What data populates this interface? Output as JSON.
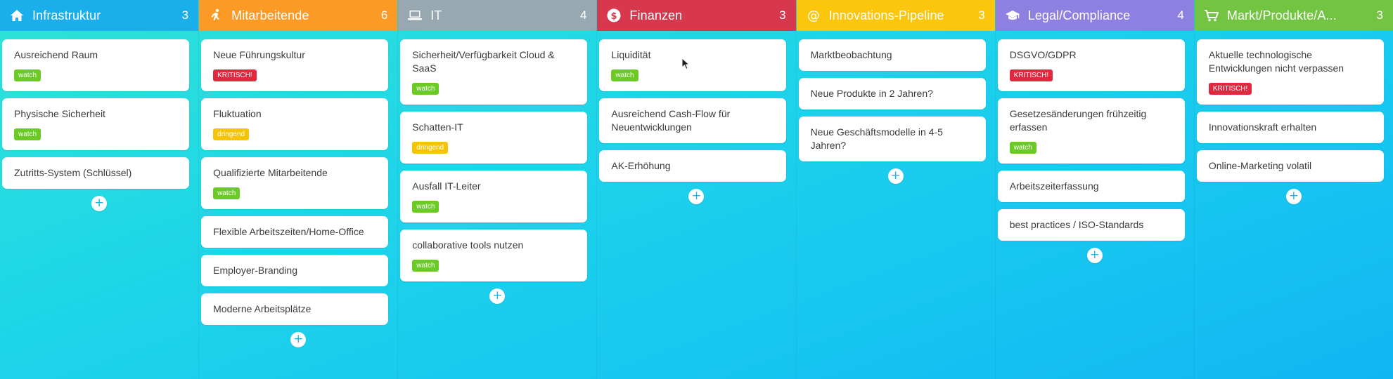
{
  "colors": {
    "watch": "#6bcb24",
    "kritisch": "#e0283f",
    "dringend": "#f5c505"
  },
  "columns": [
    {
      "title": "Infrastruktur",
      "count": "3",
      "color": "#1aaeeb",
      "icon": "house-icon",
      "cards": [
        {
          "title": "Ausreichend Raum",
          "badge": "watch",
          "badge_type": "watch"
        },
        {
          "title": "Physische Sicherheit",
          "badge": "watch",
          "badge_type": "watch"
        },
        {
          "title": "Zutritts-System (Schlüssel)"
        }
      ]
    },
    {
      "title": "Mitarbeitende",
      "count": "6",
      "color": "#fb9b26",
      "icon": "runner-icon",
      "cards": [
        {
          "title": "Neue Führungskultur",
          "badge": "KRITISCH!",
          "badge_type": "kritisch"
        },
        {
          "title": "Fluktuation",
          "badge": "dringend",
          "badge_type": "dringend"
        },
        {
          "title": "Qualifizierte Mitarbeitende",
          "badge": "watch",
          "badge_type": "watch"
        },
        {
          "title": "Flexible Arbeitszeiten/Home-Office"
        },
        {
          "title": "Employer-Branding"
        },
        {
          "title": "Moderne Arbeitsplätze"
        }
      ]
    },
    {
      "title": "IT",
      "count": "4",
      "color": "#98a8b1",
      "icon": "laptop-icon",
      "cards": [
        {
          "title": "Sicherheit/Verfügbarkeit Cloud & SaaS",
          "badge": "watch",
          "badge_type": "watch"
        },
        {
          "title": "Schatten-IT",
          "badge": "dringend",
          "badge_type": "dringend"
        },
        {
          "title": "Ausfall IT-Leiter",
          "badge": "watch",
          "badge_type": "watch"
        },
        {
          "title": "collaborative tools nutzen",
          "badge": "watch",
          "badge_type": "watch"
        }
      ]
    },
    {
      "title": "Finanzen",
      "count": "3",
      "color": "#d8384e",
      "icon": "dollar-icon",
      "cards": [
        {
          "title": "Liquidität",
          "badge": "watch",
          "badge_type": "watch"
        },
        {
          "title": "Ausreichend Cash-Flow für Neuentwicklungen"
        },
        {
          "title": "AK-Erhöhung"
        }
      ]
    },
    {
      "title": "Innovations-Pipeline",
      "count": "3",
      "color": "#fcc60c",
      "icon": "at-icon",
      "cards": [
        {
          "title": "Marktbeobachtung"
        },
        {
          "title": "Neue Produkte in 2 Jahren?"
        },
        {
          "title": "Neue Geschäftsmodelle in 4-5 Jahren?"
        }
      ]
    },
    {
      "title": "Legal/Compliance",
      "count": "4",
      "color": "#8d80e0",
      "icon": "graduation-cap-icon",
      "cards": [
        {
          "title": "DSGVO/GDPR",
          "badge": "KRITISCH!",
          "badge_type": "kritisch"
        },
        {
          "title": "Gesetzesänderungen frühzeitig erfassen",
          "badge": "watch",
          "badge_type": "watch"
        },
        {
          "title": "Arbeitszeiterfassung"
        },
        {
          "title": "best practices / ISO-Standards"
        }
      ]
    },
    {
      "title": "Markt/Produkte/A...",
      "count": "3",
      "color": "#72c442",
      "icon": "cart-icon",
      "cards": [
        {
          "title": "Aktuelle technologische Entwicklungen nicht verpassen",
          "badge": "KRITISCH!",
          "badge_type": "kritisch"
        },
        {
          "title": "Innovationskraft erhalten"
        },
        {
          "title": "Online-Marketing volatil"
        }
      ]
    }
  ],
  "add_label": "+"
}
